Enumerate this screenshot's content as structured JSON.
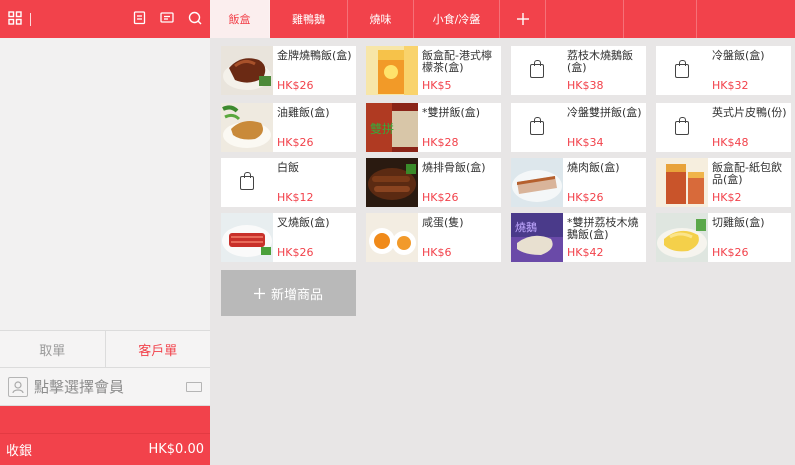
{
  "left_panel": {
    "tabs": [
      "取單",
      "客戶單"
    ],
    "member_placeholder": "點擊選擇會員",
    "checkout_label": "收銀",
    "total": "HK$0.00"
  },
  "top_tabs": [
    "飯盒",
    "雞鴨鵝",
    "燒味",
    "小食/冷盤"
  ],
  "products": [
    {
      "name": "金牌燒鴨飯(盒)",
      "price": "HK$26",
      "image": "roast-duck-rice"
    },
    {
      "name": "飯盒配-港式檸檬茶(盒)",
      "price": "HK$5",
      "image": "lemon-tea"
    },
    {
      "name": "荔枝木燒鵝飯(盒)",
      "price": "HK$38",
      "image": "bag-icon"
    },
    {
      "name": "冷盤飯(盒)",
      "price": "HK$32",
      "image": "bag-icon"
    },
    {
      "name": "油雞飯(盒)",
      "price": "HK$26",
      "image": "soy-chicken-rice"
    },
    {
      "name": "*雙拼飯(盒)",
      "price": "HK$28",
      "image": "double-combo"
    },
    {
      "name": "冷盤雙拼飯(盒)",
      "price": "HK$34",
      "image": "bag-icon"
    },
    {
      "name": "英式片皮鴨(份)",
      "price": "HK$48",
      "image": "bag-icon"
    },
    {
      "name": "白飯",
      "price": "HK$12",
      "image": "bag-icon"
    },
    {
      "name": "燒排骨飯(盒)",
      "price": "HK$26",
      "image": "bbq-ribs"
    },
    {
      "name": "燒肉飯(盒)",
      "price": "HK$26",
      "image": "roast-pork"
    },
    {
      "name": "飯盒配-紙包飲品(盒)",
      "price": "HK$2",
      "image": "paper-drink"
    },
    {
      "name": "叉燒飯(盒)",
      "price": "HK$26",
      "image": "char-siu-rice"
    },
    {
      "name": "咸蛋(隻)",
      "price": "HK$6",
      "image": "salted-egg"
    },
    {
      "name": "*雙拼荔枝木燒鵝飯(盒)",
      "price": "HK$42",
      "image": "double-goose"
    },
    {
      "name": "切雞飯(盒)",
      "price": "HK$26",
      "image": "steamed-chicken"
    }
  ],
  "add_product_label": "新增商品",
  "colors": {
    "accent": "#f2424b",
    "bg": "#e8e6e6"
  }
}
